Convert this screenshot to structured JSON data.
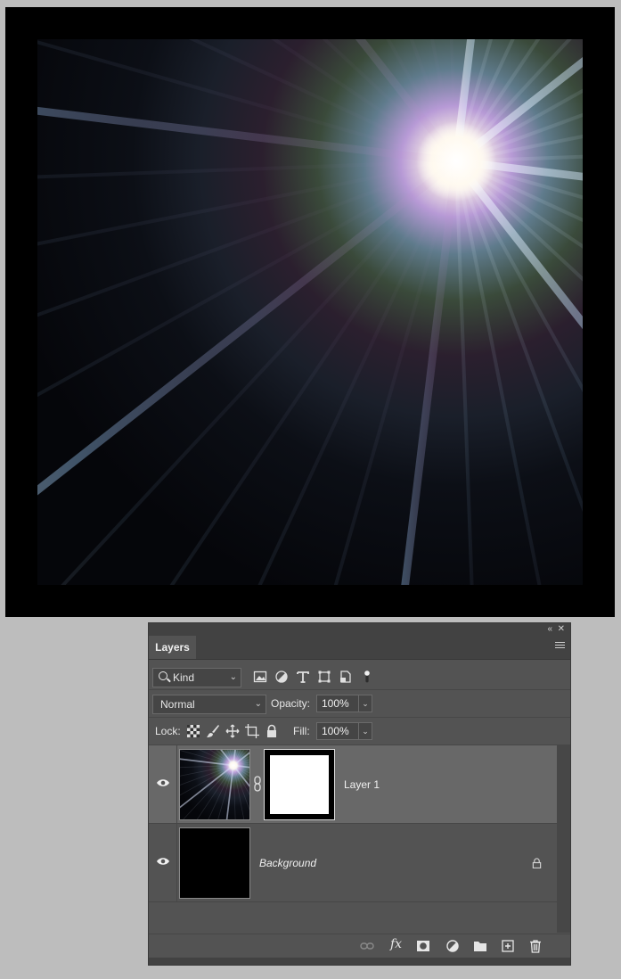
{
  "canvas": {
    "description_icon": "lens-flare-starburst"
  },
  "panel": {
    "tab_label": "Layers",
    "collapse_glyph": "«",
    "close_glyph": "✕",
    "filter": {
      "kind_label": "Kind"
    },
    "blend": {
      "mode": "Normal",
      "opacity_label": "Opacity:",
      "opacity_value": "100%"
    },
    "lock": {
      "lock_label": "Lock:",
      "fill_label": "Fill:",
      "fill_value": "100%"
    },
    "layers": [
      {
        "name": "Layer 1",
        "selected": true,
        "has_mask": true
      },
      {
        "name": "Background",
        "selected": false,
        "locked": true
      }
    ]
  },
  "colors": {
    "panel_bg": "#535353",
    "selected_row": "#686868",
    "app_bg": "#bdbdbd"
  }
}
